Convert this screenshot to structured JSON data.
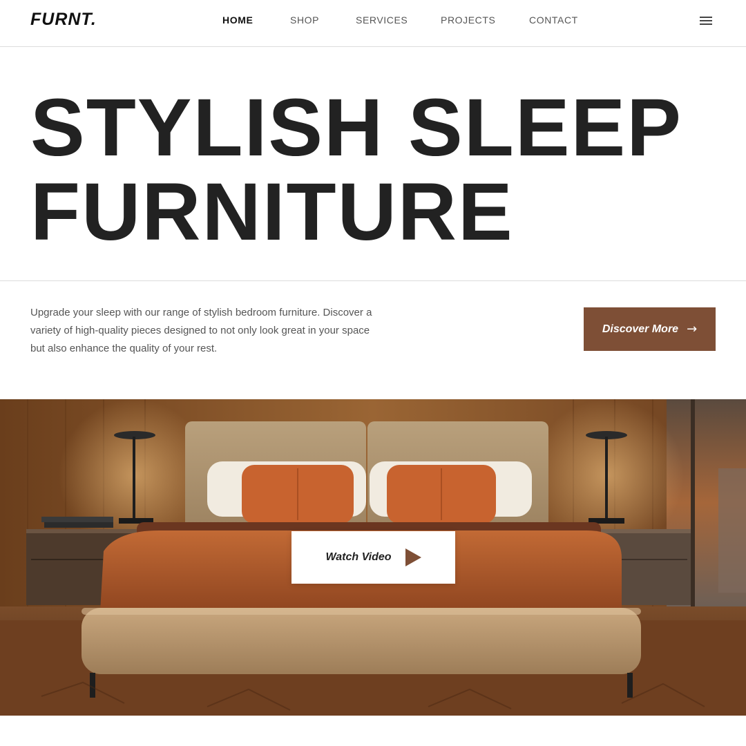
{
  "header": {
    "logo": "FURNT.",
    "nav": [
      {
        "label": "HOME",
        "active": true
      },
      {
        "label": "SHOP",
        "active": false
      },
      {
        "label": "SERVICES",
        "active": false
      },
      {
        "label": "PROJECTS",
        "active": false
      },
      {
        "label": "CONTACT",
        "active": false
      }
    ],
    "menu_icon": "hamburger-menu-icon"
  },
  "hero": {
    "title_line1": "STYLISH SLEEP",
    "title_line2": "FURNITURE",
    "intro_line1": "Upgrade your sleep with our range of stylish bedroom furniture. Discover a",
    "intro_line2": "variety of high-quality pieces designed to not only look great in your space",
    "intro_line3": "but also enhance the quality of your rest.",
    "cta_label": "Discover More",
    "cta_icon": "arrow-right-icon"
  },
  "media": {
    "watch_label": "Watch Video",
    "play_icon": "play-icon"
  },
  "colors": {
    "accent": "#7e4f36",
    "text_dark": "#222222",
    "text_muted": "#555555"
  }
}
